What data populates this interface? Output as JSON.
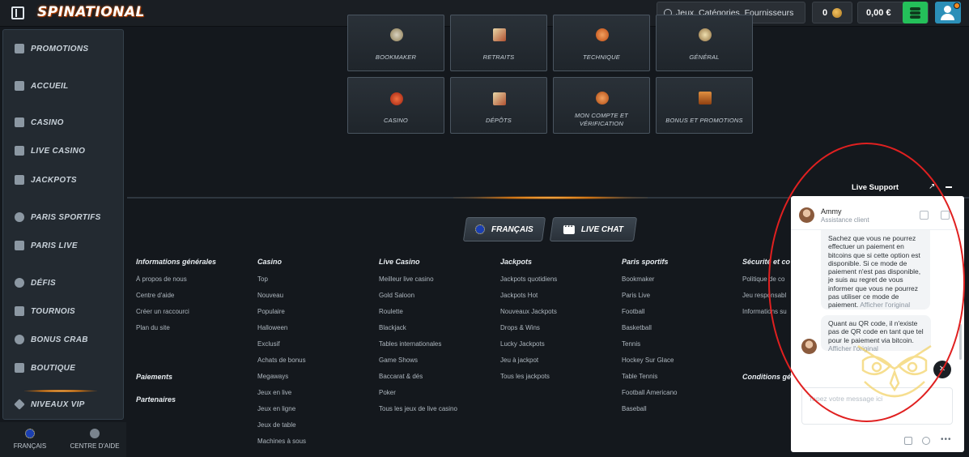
{
  "header": {
    "logo": "SPINATIONAL",
    "search_placeholder": "Jeux, Catégories, Fournisseurs",
    "coins": "0",
    "balance": "0,00 €"
  },
  "sidebar": {
    "items": [
      {
        "label": "PROMOTIONS",
        "icon": "gift-icon"
      },
      {
        "label": "ACCUEIL",
        "icon": "home-icon"
      },
      {
        "label": "CASINO",
        "icon": "slot-icon"
      },
      {
        "label": "LIVE CASINO",
        "icon": "cards-icon"
      },
      {
        "label": "JACKPOTS",
        "icon": "jackpot-icon"
      },
      {
        "label": "PARIS SPORTIFS",
        "icon": "soccer-ball-icon"
      },
      {
        "label": "PARIS LIVE",
        "icon": "live-icon"
      },
      {
        "label": "DÉFIS",
        "icon": "medal-icon"
      },
      {
        "label": "TOURNOIS",
        "icon": "trophy-icon"
      },
      {
        "label": "BONUS CRAB",
        "icon": "crab-icon"
      },
      {
        "label": "BOUTIQUE",
        "icon": "shop-icon"
      },
      {
        "label": "NIVEAUX VIP",
        "icon": "diamond-icon"
      }
    ],
    "language": "FRANÇAIS",
    "help": "CENTRE D'AIDE"
  },
  "categories": [
    {
      "label": "BOOKMAKER",
      "icon": "ball-icon"
    },
    {
      "label": "RETRAITS",
      "icon": "cash-icon"
    },
    {
      "label": "TECHNIQUE",
      "icon": "gear-icon"
    },
    {
      "label": "GÉNÉRAL",
      "icon": "info-icon"
    },
    {
      "label": "CASINO",
      "icon": "cherries-icon"
    },
    {
      "label": "DÉPÔTS",
      "icon": "deposit-icon"
    },
    {
      "label": "MON COMPTE ET VÉRIFICATION",
      "icon": "account-icon"
    },
    {
      "label": "BONUS ET PROMOTIONS",
      "icon": "chest-icon"
    }
  ],
  "footer": {
    "language_button": "FRANÇAIS",
    "live_chat_button": "LIVE CHAT",
    "columns": [
      {
        "title": "Informations générales",
        "links": [
          "À propos de nous",
          "Centre d'aide",
          "Créer un raccourci",
          "Plan du site"
        ]
      },
      {
        "title": "Casino",
        "links": [
          "Top",
          "Nouveau",
          "Populaire",
          "Halloween",
          "Exclusif",
          "Achats de bonus",
          "Megaways",
          "Jeux en live",
          "Jeux en ligne",
          "Jeux de table",
          "Machines à sous"
        ]
      },
      {
        "title": "Live Casino",
        "links": [
          "Meilleur live casino",
          "Gold Saloon",
          "Roulette",
          "Blackjack",
          "Tables internationales",
          "Game Shows",
          "Baccarat & dés",
          "Poker",
          "Tous les jeux de live casino"
        ]
      },
      {
        "title": "Jackpots",
        "links": [
          "Jackpots quotidiens",
          "Jackpots Hot",
          "Nouveaux Jackpots",
          "Drops & Wins",
          "Lucky Jackpots",
          "Jeu à jackpot",
          "Tous les jackpots"
        ]
      },
      {
        "title": "Paris sportifs",
        "links": [
          "Bookmaker",
          "Paris Live",
          "Football",
          "Basketball",
          "Tennis",
          "Hockey Sur Glace",
          "Table Tennis",
          "Football Americano",
          "Baseball"
        ]
      },
      {
        "title": "Sécurité et co",
        "links": [
          "Politique de co",
          "Jeu responsabl",
          "Informations su"
        ]
      }
    ],
    "paiements": "Paiements",
    "partenaires": "Partenaires",
    "conditions": "Conditions gé"
  },
  "live_support": {
    "title": "Live Support",
    "agent_name": "Ammy",
    "agent_role": "Assistance client",
    "message1": "Sachez que vous ne pourrez effectuer un paiement en bitcoins que si cette option est disponible. Si ce mode de paiement n'est pas disponible, je suis au regret de vous informer que vous ne pourrez pas utiliser ce mode de paiement.",
    "message2": "Quant au QR code, il n'existe pas de QR code en tant que tel pour le paiement via bitcoin.",
    "show_original": "Afficher l'original",
    "input_placeholder": "Tapez votre message ici"
  }
}
